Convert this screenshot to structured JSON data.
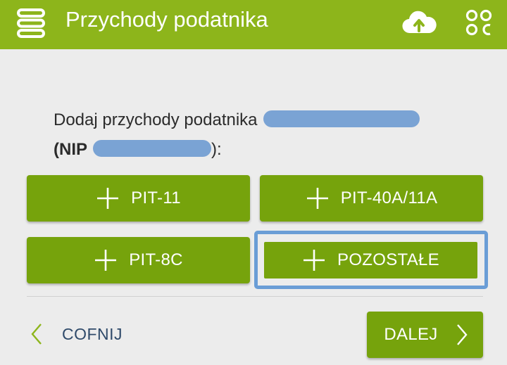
{
  "header": {
    "title": "Przychody podatnika",
    "menu_icon": "menu-stack-icon",
    "cloud_icon": "cloud-upload-icon",
    "apps_icon": "apps-grid-icon",
    "color": "#8db51b"
  },
  "prompt": {
    "line1": "Dodaj przychody podatnika",
    "nip_label": "(NIP",
    "close": "):"
  },
  "buttons": {
    "pit11": "PIT-11",
    "pit40": "PIT-40A/11A",
    "pit8c": "PIT-8C",
    "pozostale": "POZOSTAŁE",
    "color": "#76a30c",
    "selected_outline": "#6a9dd6"
  },
  "footer": {
    "back": "COFNIJ",
    "next": "DALEJ"
  }
}
